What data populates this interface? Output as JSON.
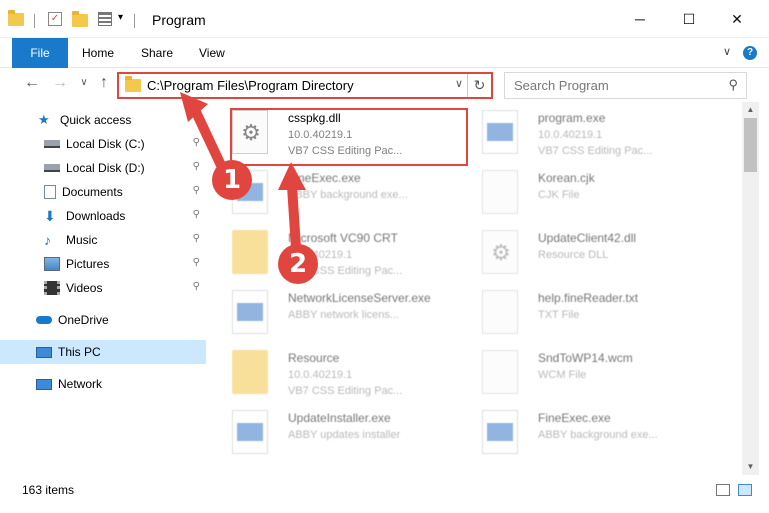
{
  "window": {
    "title": "Program",
    "minimize": "─",
    "maximize": "☐",
    "close": "✕"
  },
  "ribbon": {
    "tabs": [
      "File",
      "Home",
      "Share",
      "View"
    ],
    "help": "?",
    "collapse": "∨"
  },
  "nav": {
    "back": "←",
    "forward": "→",
    "recent": "∨",
    "up": "↑",
    "address": "C:\\Program Files\\Program Directory",
    "address_dropdown": "∨",
    "refresh": "↻",
    "search_placeholder": "Search Program",
    "search_icon": "⚲"
  },
  "sidebar": {
    "items": [
      {
        "label": "Quick access",
        "icon": "star-icon",
        "pinned": false
      },
      {
        "label": "Local Disk (C:)",
        "icon": "drive-icon",
        "pinned": true
      },
      {
        "label": "Local Disk (D:)",
        "icon": "drive-icon",
        "pinned": true
      },
      {
        "label": "Documents",
        "icon": "documents-icon",
        "pinned": true
      },
      {
        "label": "Downloads",
        "icon": "download-icon",
        "pinned": true
      },
      {
        "label": "Music",
        "icon": "music-icon",
        "pinned": true
      },
      {
        "label": "Pictures",
        "icon": "pictures-icon",
        "pinned": true
      },
      {
        "label": "Videos",
        "icon": "videos-icon",
        "pinned": true
      },
      {
        "label": "OneDrive",
        "icon": "cloud-icon",
        "pinned": false
      },
      {
        "label": "This PC",
        "icon": "computer-icon",
        "pinned": false,
        "selected": true
      },
      {
        "label": "Network",
        "icon": "network-icon",
        "pinned": false
      }
    ],
    "pin_glyph": "📌"
  },
  "files": [
    {
      "name": "csspkg.dll",
      "line1": "10.0.40219.1",
      "line2": "VB7 CSS Editing Pac...",
      "icon": "dll-icon",
      "highlighted": true
    },
    {
      "name": "program.exe",
      "line1": "10.0.40219.1",
      "line2": "VB7 CSS Editing Pac...",
      "icon": "exe-icon"
    },
    {
      "name": "FineExec.exe",
      "line1": "ABBY background exe...",
      "line2": "",
      "icon": "exe-icon"
    },
    {
      "name": "Korean.cjk",
      "line1": "CJK File",
      "line2": "",
      "icon": "document-icon"
    },
    {
      "name": "Microsoft VC90 CRT",
      "line1": "10.0.40219.1",
      "line2": "VB7 CSS Editing Pac...",
      "icon": "folder-icon"
    },
    {
      "name": "UpdateClient42.dll",
      "line1": "Resource DLL",
      "line2": "",
      "icon": "dll-icon"
    },
    {
      "name": "NetworkLicenseServer.exe",
      "line1": "ABBY network licens...",
      "line2": "",
      "icon": "exe-icon"
    },
    {
      "name": "help.fineReader.txt",
      "line1": "TXT File",
      "line2": "",
      "icon": "document-icon"
    },
    {
      "name": "Resource",
      "line1": "10.0.40219.1",
      "line2": "VB7 CSS Editing Pac...",
      "icon": "folder-icon"
    },
    {
      "name": "SndToWP14.wcm",
      "line1": "WCM File",
      "line2": "",
      "icon": "document-icon"
    },
    {
      "name": "UpdateInstaller.exe",
      "line1": "ABBY updates installer",
      "line2": "",
      "icon": "exe-icon"
    },
    {
      "name": "FineExec.exe",
      "line1": "ABBY background exe...",
      "line2": "",
      "icon": "exe-icon"
    }
  ],
  "status": {
    "count": "163 items"
  },
  "annotations": {
    "step1": "1",
    "step2": "2"
  },
  "colors": {
    "accent": "#1979ca",
    "highlight_red": "#e0463f",
    "selected_bg": "#cce8ff"
  }
}
